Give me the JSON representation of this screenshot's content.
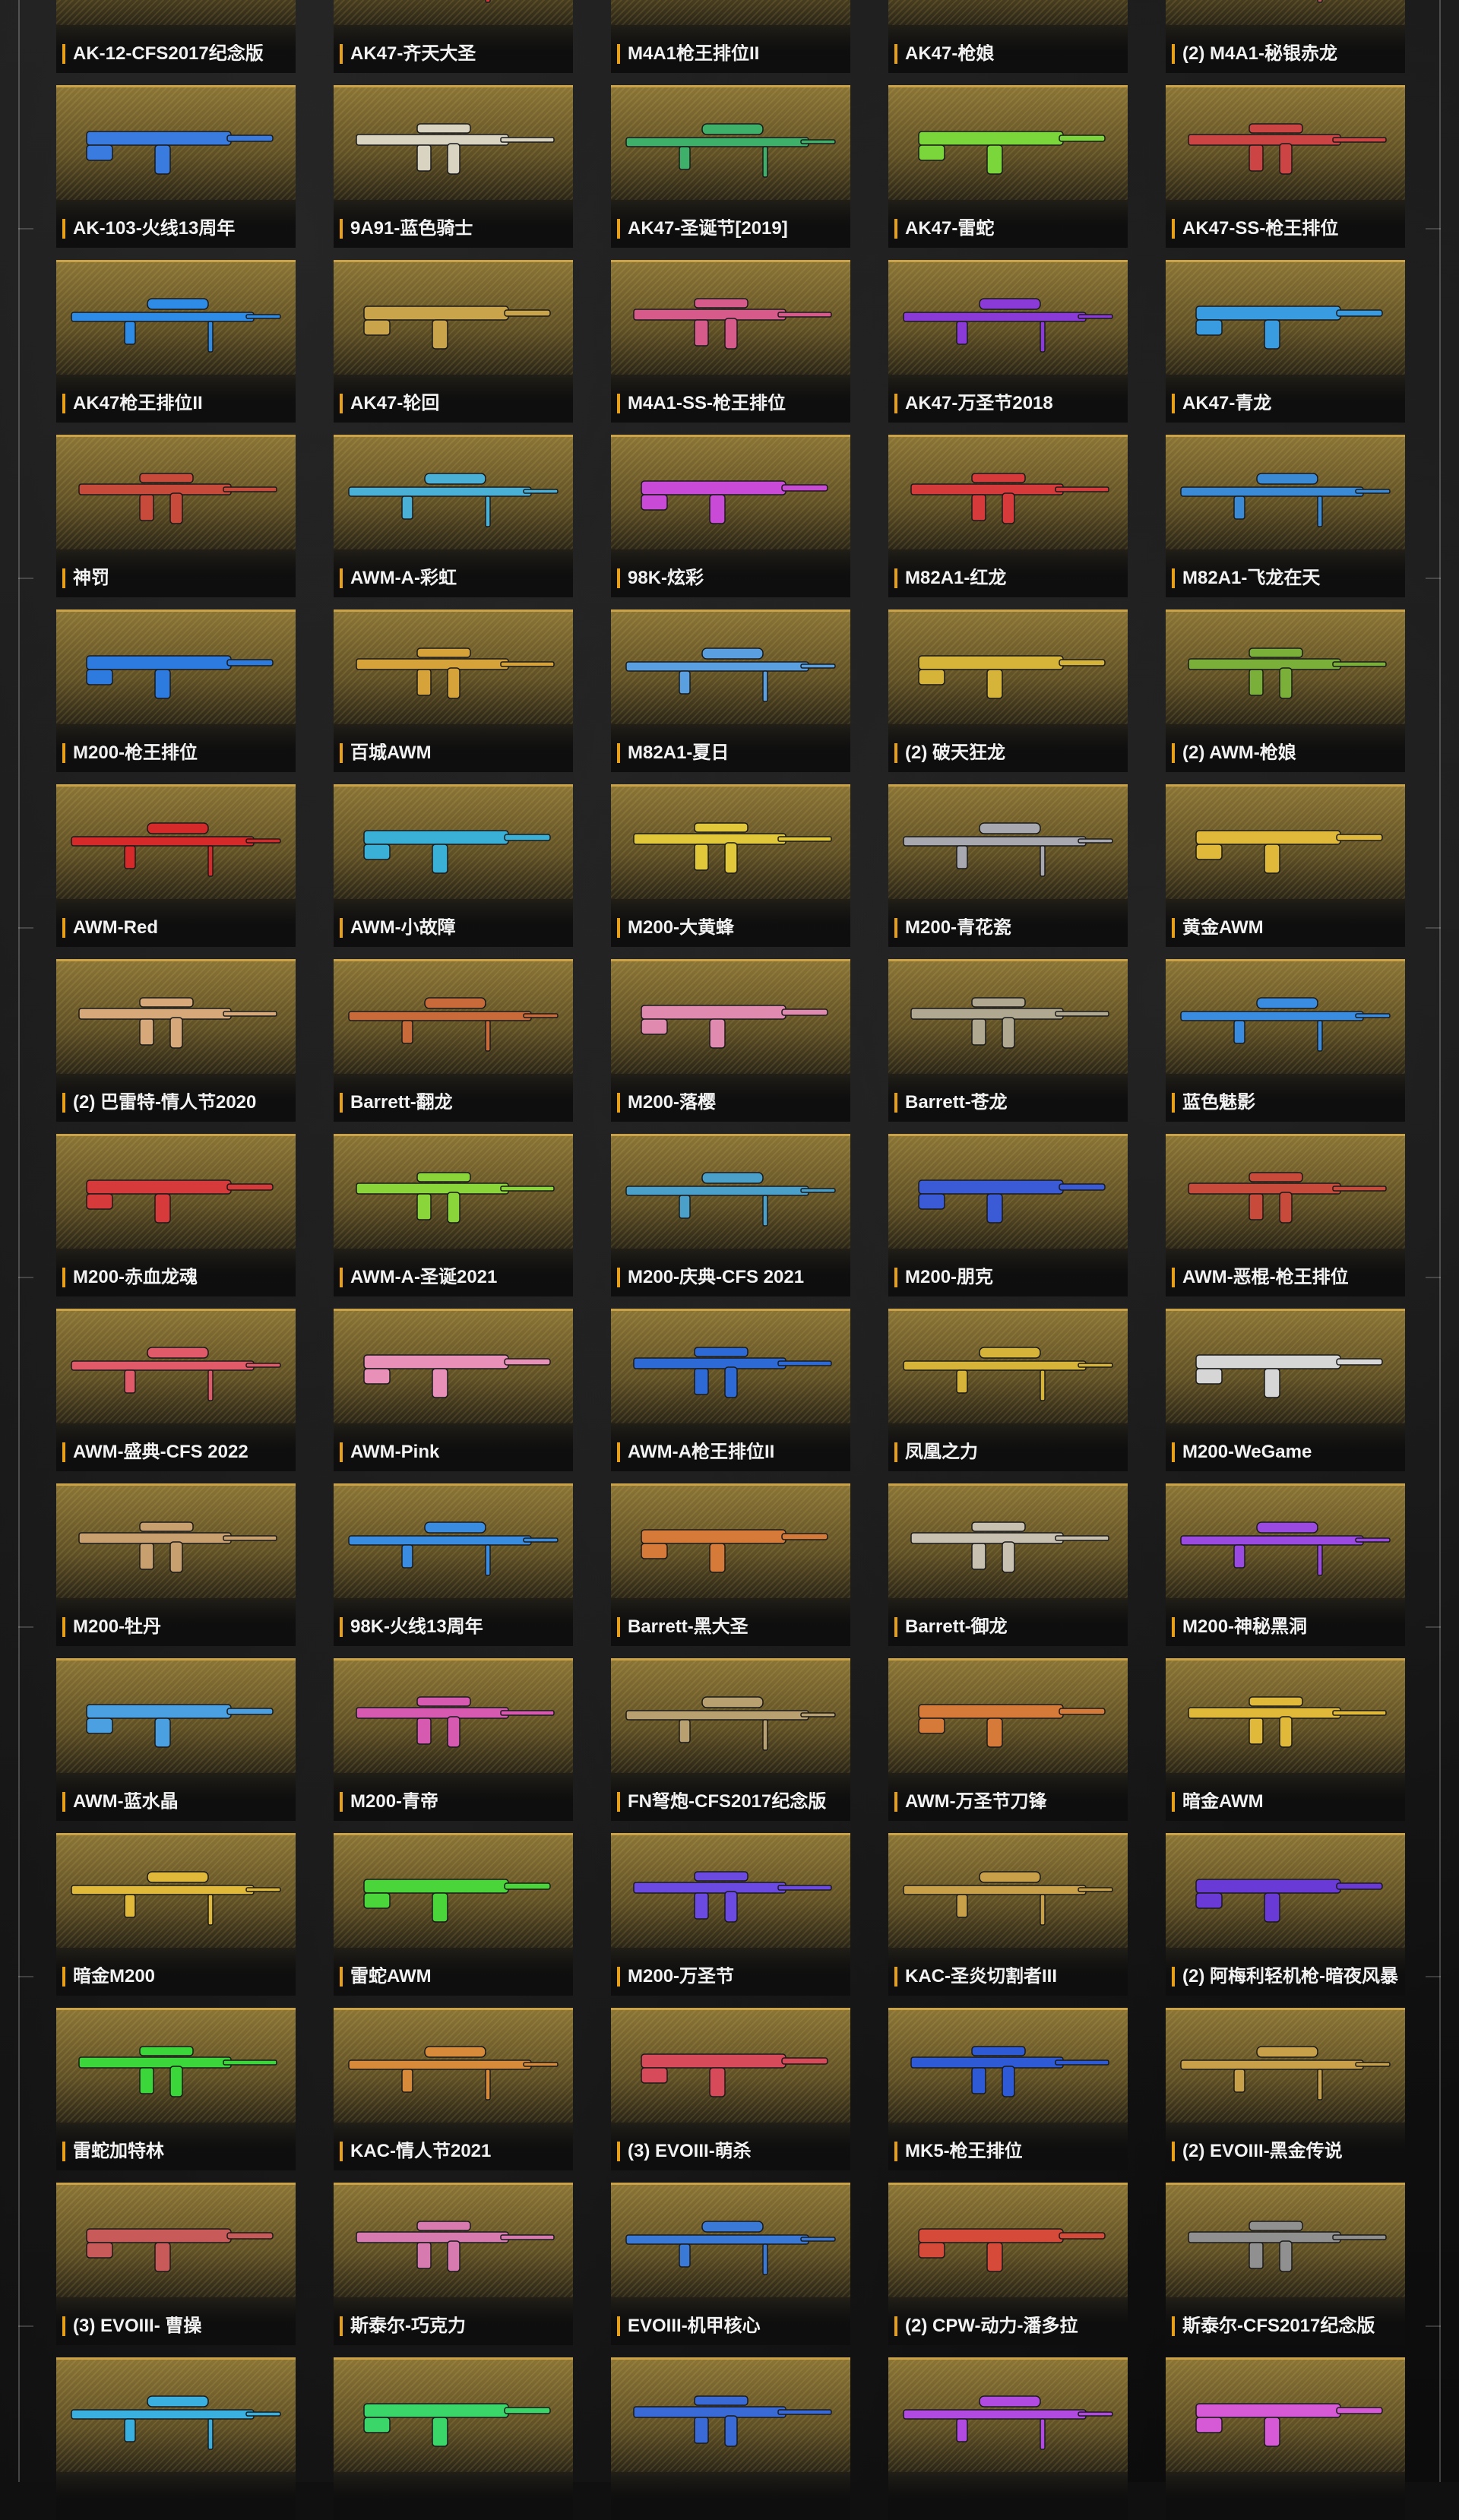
{
  "colors": {
    "accent": "#e8a019",
    "card_gold": "#8a7436",
    "label_text": "#f2f2f2"
  },
  "items": [
    {
      "label": "AK-12-CFS2017纪念版",
      "color": "#c83a3a"
    },
    {
      "label": "AK47-齐天大圣",
      "color": "#d13a3a"
    },
    {
      "label": "M4A1枪王排位II",
      "color": "#2f6fd6"
    },
    {
      "label": "AK47-枪娘",
      "color": "#d84a6a"
    },
    {
      "label": "(2) M4A1-秘银赤龙",
      "color": "#b85a5a"
    },
    {
      "label": "AK-103-火线13周年",
      "color": "#3a7be0"
    },
    {
      "label": "9A91-蓝色骑士",
      "color": "#d9d3c2"
    },
    {
      "label": "AK47-圣诞节[2019]",
      "color": "#3fb06a"
    },
    {
      "label": "AK47-雷蛇",
      "color": "#7ad63a"
    },
    {
      "label": "AK47-SS-枪王排位",
      "color": "#c44"
    },
    {
      "label": "AK47枪王排位II",
      "color": "#2e8ce6"
    },
    {
      "label": "AK47-轮回",
      "color": "#c9a44a"
    },
    {
      "label": "M4A1-SS-枪王排位",
      "color": "#d65a8a"
    },
    {
      "label": "AK47-万圣节2018",
      "color": "#8a3ad6"
    },
    {
      "label": "AK47-青龙",
      "color": "#3a9ce0"
    },
    {
      "label": "神罚",
      "color": "#c84a3a"
    },
    {
      "label": "AWM-A-彩虹",
      "color": "#4ab0d6"
    },
    {
      "label": "98K-炫彩",
      "color": "#c84ad6"
    },
    {
      "label": "M82A1-红龙",
      "color": "#d63a3a"
    },
    {
      "label": "M82A1-飞龙在天",
      "color": "#3a8ad6"
    },
    {
      "label": "M200-枪王排位",
      "color": "#2e7be0"
    },
    {
      "label": "百城AWM",
      "color": "#d6a23a"
    },
    {
      "label": "M82A1-夏日",
      "color": "#5aa0e0"
    },
    {
      "label": "(2) 破天狂龙",
      "color": "#d6b43a"
    },
    {
      "label": "(2) AWM-枪娘",
      "color": "#7ab03a"
    },
    {
      "label": "AWM-Red",
      "color": "#d62a2a"
    },
    {
      "label": "AWM-小故障",
      "color": "#3ab0d6"
    },
    {
      "label": "M200-大黄蜂",
      "color": "#e0c83a"
    },
    {
      "label": "M200-青花瓷",
      "color": "#a8a8b0"
    },
    {
      "label": "黄金AWM",
      "color": "#e0b83a"
    },
    {
      "label": "(2) 巴雷特-情人节2020",
      "color": "#d6a87a"
    },
    {
      "label": "Barrett-翻龙",
      "color": "#c86a3a"
    },
    {
      "label": "M200-落樱",
      "color": "#e08ab0"
    },
    {
      "label": "Barrett-苍龙",
      "color": "#b0a890"
    },
    {
      "label": "蓝色魅影",
      "color": "#3a8ce0"
    },
    {
      "label": "M200-赤血龙魂",
      "color": "#d63a3a"
    },
    {
      "label": "AWM-A-圣诞2021",
      "color": "#8ad63a"
    },
    {
      "label": "M200-庆典-CFS 2021",
      "color": "#4aa0c8"
    },
    {
      "label": "M200-朋克",
      "color": "#3a5ad6"
    },
    {
      "label": "AWM-恶棍-枪王排位",
      "color": "#c84a3a"
    },
    {
      "label": "AWM-盛典-CFS 2022",
      "color": "#e05a6a"
    },
    {
      "label": "AWM-Pink",
      "color": "#e890b8"
    },
    {
      "label": "AWM-A枪王排位II",
      "color": "#2e6ad6"
    },
    {
      "label": "凤凰之力",
      "color": "#d6b43a"
    },
    {
      "label": "M200-WeGame",
      "color": "#d6d6d6"
    },
    {
      "label": "M200-牡丹",
      "color": "#c8a070"
    },
    {
      "label": "98K-火线13周年",
      "color": "#3a8ce0"
    },
    {
      "label": "Barrett-黑大圣",
      "color": "#d67a3a"
    },
    {
      "label": "Barrett-御龙",
      "color": "#c8c0b0"
    },
    {
      "label": "M200-神秘黑洞",
      "color": "#9a4ae0"
    },
    {
      "label": "AWM-蓝水晶",
      "color": "#4aa0e0"
    },
    {
      "label": "M200-青帝",
      "color": "#d65ab0"
    },
    {
      "label": "FN弩炮-CFS2017纪念版",
      "color": "#b8a070"
    },
    {
      "label": "AWM-万圣节刀锋",
      "color": "#d67a3a"
    },
    {
      "label": "暗金AWM",
      "color": "#e0b83a"
    },
    {
      "label": "暗金M200",
      "color": "#e0b83a"
    },
    {
      "label": "雷蛇AWM",
      "color": "#4ad63a"
    },
    {
      "label": "M200-万圣节",
      "color": "#6a4ae0"
    },
    {
      "label": "KAC-圣炎切割者III",
      "color": "#c8a04a"
    },
    {
      "label": "(2) 阿梅利轻机枪-暗夜风暴",
      "color": "#6a3ad6"
    },
    {
      "label": "雷蛇加特林",
      "color": "#3ad63a"
    },
    {
      "label": "KAC-情人节2021",
      "color": "#d68a3a"
    },
    {
      "label": "(3) EVOIII-萌杀",
      "color": "#d64a5a"
    },
    {
      "label": "MK5-枪王排位",
      "color": "#2e5ad6"
    },
    {
      "label": "(2) EVOIII-黑金传说",
      "color": "#c8a04a"
    },
    {
      "label": "(3) EVOIII- 曹操",
      "color": "#c85a5a"
    },
    {
      "label": "斯泰尔-巧克力",
      "color": "#d67ab0"
    },
    {
      "label": "EVOIII-机甲核心",
      "color": "#3a7ad6"
    },
    {
      "label": "(2) CPW-动力-潘多拉",
      "color": "#d64a3a"
    },
    {
      "label": "斯泰尔-CFS2017纪念版",
      "color": "#909090"
    },
    {
      "label": "",
      "color": "#3ab0e0"
    },
    {
      "label": "",
      "color": "#3ad66a"
    },
    {
      "label": "",
      "color": "#3a6ad6"
    },
    {
      "label": "",
      "color": "#b04ae0"
    },
    {
      "label": "",
      "color": "#d65ad6"
    }
  ]
}
